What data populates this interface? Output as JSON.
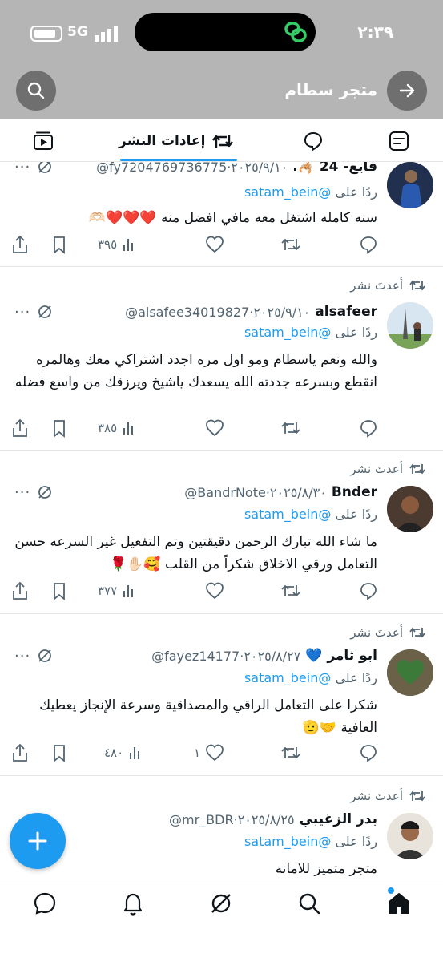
{
  "status_bar": {
    "time": "٢:٣٩",
    "network": "5G"
  },
  "header": {
    "store_name": "متجر سطام"
  },
  "tabs": {
    "active_label": "إعادات النشر"
  },
  "colors": {
    "accent": "#1d9bf0",
    "like_red": "#e0245e",
    "header_grey": "#b5b5b5"
  },
  "feed": [
    {
      "repost_label": "",
      "name": "فايع- 24 🦂.",
      "handle": "@fy7204769736775",
      "date": "٢٠٢٥/٩/١٠",
      "reply_prefix": "ردًا على",
      "reply_mention": "@satam_bein",
      "text": "سنه كامله اشتغل معه مافي افضل منه ❤️❤️❤️🫶🏻",
      "views": "٣٩٥",
      "likes": ""
    },
    {
      "repost_label": "أعدتَ نشر",
      "name": "alsafeer",
      "handle": "@alsafee34019827",
      "date": "٢٠٢٥/٩/١٠",
      "reply_prefix": "ردًا على",
      "reply_mention": "@satam_bein",
      "text": "والله ونعم ياسطام ومو اول مره اجدد اشتراكي معك وهالمره انقطع وبسرعه جددته الله يسعدك ياشيخ ويرزقك من واسع فضله",
      "views": "٣٨٥",
      "likes": ""
    },
    {
      "repost_label": "أعدتَ نشر",
      "name": "Bnder",
      "handle": "@BandrNote",
      "date": "٢٠٢٥/٨/٣٠",
      "reply_prefix": "ردًا على",
      "reply_mention": "@satam_bein",
      "text": "ما شاء الله تبارك الرحمن دقيقتين وتم التفعيل غير السرعه حسن التعامل ورقي الاخلاق شكراً من القلب 🥰✋🏻🌹",
      "views": "٣٧٧",
      "likes": ""
    },
    {
      "repost_label": "أعدتَ نشر",
      "name": "ابو ثامر 💙",
      "handle": "@fayez14177",
      "date": "٢٠٢٥/٨/٢٧",
      "reply_prefix": "ردًا على",
      "reply_mention": "@satam_bein",
      "text": "شكرا على التعامل الراقي والمصداقية وسرعة الإنجاز يعطيك العافية 🤝🫡",
      "views": "٤٨٠",
      "likes": "١"
    },
    {
      "repost_label": "أعدتَ نشر",
      "name": "بدر الزغيبي",
      "handle": "@mr_BDR",
      "date": "٢٠٢٥/٨/٢٥",
      "reply_prefix": "ردًا على",
      "reply_mention": "@satam_bein",
      "text": "متجر متميز للامانه",
      "views": "",
      "likes": ""
    }
  ]
}
